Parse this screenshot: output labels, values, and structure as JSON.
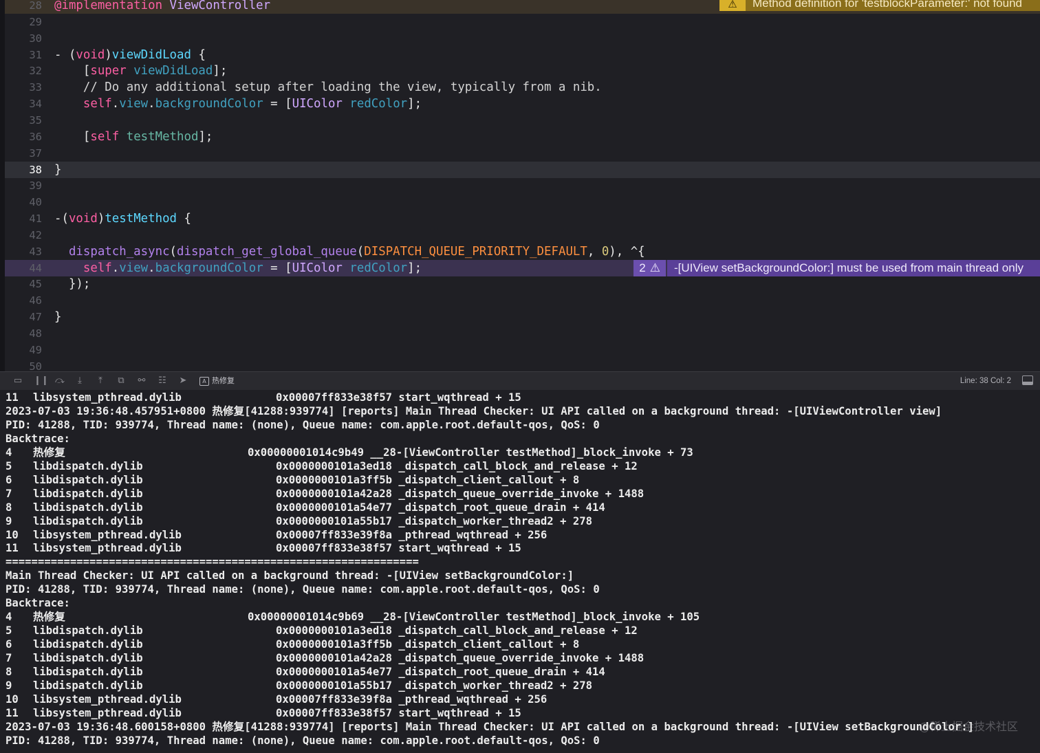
{
  "editor": {
    "lines": [
      {
        "no": "28",
        "tokens": [
          {
            "t": "@implementation",
            "c": "t-at"
          },
          {
            "t": " ",
            "c": "t-plain"
          },
          {
            "t": "ViewController",
            "c": "t-cls"
          }
        ],
        "kind": "warn"
      },
      {
        "no": "29",
        "tokens": []
      },
      {
        "no": "30",
        "tokens": []
      },
      {
        "no": "31",
        "tokens": [
          {
            "t": "- (",
            "c": "t-plain"
          },
          {
            "t": "void",
            "c": "t-kw"
          },
          {
            "t": ")",
            "c": "t-plain"
          },
          {
            "t": "viewDidLoad",
            "c": "t-prop"
          },
          {
            "t": " {",
            "c": "t-plain"
          }
        ]
      },
      {
        "no": "32",
        "tokens": [
          {
            "t": "    [",
            "c": "t-plain"
          },
          {
            "t": "super",
            "c": "t-kw"
          },
          {
            "t": " ",
            "c": "t-plain"
          },
          {
            "t": "viewDidLoad",
            "c": "t-method"
          },
          {
            "t": "];",
            "c": "t-plain"
          }
        ]
      },
      {
        "no": "33",
        "tokens": [
          {
            "t": "    // Do any additional setup after loading the view, typically from a nib.",
            "c": "t-cmt"
          }
        ]
      },
      {
        "no": "34",
        "tokens": [
          {
            "t": "    ",
            "c": "t-plain"
          },
          {
            "t": "self",
            "c": "t-self"
          },
          {
            "t": ".",
            "c": "t-plain"
          },
          {
            "t": "view",
            "c": "t-method"
          },
          {
            "t": ".",
            "c": "t-plain"
          },
          {
            "t": "backgroundColor",
            "c": "t-method"
          },
          {
            "t": " = [",
            "c": "t-plain"
          },
          {
            "t": "UIColor",
            "c": "t-cls"
          },
          {
            "t": " ",
            "c": "t-plain"
          },
          {
            "t": "redColor",
            "c": "t-method"
          },
          {
            "t": "];",
            "c": "t-plain"
          }
        ]
      },
      {
        "no": "35",
        "tokens": []
      },
      {
        "no": "36",
        "tokens": [
          {
            "t": "    [",
            "c": "t-plain"
          },
          {
            "t": "self",
            "c": "t-self"
          },
          {
            "t": " ",
            "c": "t-plain"
          },
          {
            "t": "testMethod",
            "c": "t-fn"
          },
          {
            "t": "];",
            "c": "t-plain"
          }
        ]
      },
      {
        "no": "37",
        "tokens": []
      },
      {
        "no": "38",
        "tokens": [
          {
            "t": "}",
            "c": "t-plain"
          }
        ],
        "kind": "current"
      },
      {
        "no": "39",
        "tokens": []
      },
      {
        "no": "40",
        "tokens": []
      },
      {
        "no": "41",
        "tokens": [
          {
            "t": "-(",
            "c": "t-plain"
          },
          {
            "t": "void",
            "c": "t-kw"
          },
          {
            "t": ")",
            "c": "t-plain"
          },
          {
            "t": "testMethod",
            "c": "t-prop"
          },
          {
            "t": " {",
            "c": "t-plain"
          }
        ]
      },
      {
        "no": "42",
        "tokens": []
      },
      {
        "no": "43",
        "tokens": [
          {
            "t": "  ",
            "c": "t-plain"
          },
          {
            "t": "dispatch_async",
            "c": "t-kw2"
          },
          {
            "t": "(",
            "c": "t-plain"
          },
          {
            "t": "dispatch_get_global_queue",
            "c": "t-kw2"
          },
          {
            "t": "(",
            "c": "t-plain"
          },
          {
            "t": "DISPATCH_QUEUE_PRIORITY_DEFAULT",
            "c": "t-macro"
          },
          {
            "t": ", ",
            "c": "t-plain"
          },
          {
            "t": "0",
            "c": "t-num"
          },
          {
            "t": "), ^{",
            "c": "t-plain"
          }
        ]
      },
      {
        "no": "44",
        "tokens": [
          {
            "t": "    ",
            "c": "t-plain"
          },
          {
            "t": "self",
            "c": "t-self"
          },
          {
            "t": ".",
            "c": "t-plain"
          },
          {
            "t": "view",
            "c": "t-method"
          },
          {
            "t": ".",
            "c": "t-plain"
          },
          {
            "t": "backgroundColor",
            "c": "t-method"
          },
          {
            "t": " = [",
            "c": "t-plain"
          },
          {
            "t": "UIColor",
            "c": "t-cls"
          },
          {
            "t": " ",
            "c": "t-plain"
          },
          {
            "t": "redColor",
            "c": "t-method"
          },
          {
            "t": "];",
            "c": "t-plain"
          }
        ],
        "kind": "runtime"
      },
      {
        "no": "45",
        "tokens": [
          {
            "t": "  });",
            "c": "t-plain"
          }
        ]
      },
      {
        "no": "46",
        "tokens": []
      },
      {
        "no": "47",
        "tokens": [
          {
            "t": "}",
            "c": "t-plain"
          }
        ]
      },
      {
        "no": "48",
        "tokens": []
      },
      {
        "no": "49",
        "tokens": []
      },
      {
        "no": "50",
        "tokens": []
      }
    ],
    "warning_issue": {
      "icon": "warning-triangle-icon",
      "message": "Method definition for 'testblockParameter:' not found"
    },
    "runtime_issue": {
      "count": "2",
      "icon": "warning-triangle-icon",
      "message": "-[UIView setBackgroundColor:] must be used from main thread only"
    }
  },
  "debug_bar": {
    "process_name": "热修复",
    "line_col": "Line: 38  Col: 2",
    "buttons": [
      "hide-console-icon",
      "pause-icon",
      "step-over-icon",
      "step-into-icon",
      "step-out-icon",
      "view-hierarchy-icon",
      "memory-graph-icon",
      "environment-icon",
      "location-icon"
    ]
  },
  "console": {
    "lines": [
      {
        "a": "11",
        "b": "libsystem_pthread.dylib",
        "c": "0x00007ff833e38f57 start_wqthread + 15",
        "offset": "short"
      },
      {
        "text": "2023-07-03 19:36:48.457951+0800 热修复[41288:939774] [reports] Main Thread Checker: UI API called on a background thread: -[UIViewController view]"
      },
      {
        "text": "PID: 41288, TID: 939774, Thread name: (none), Queue name: com.apple.root.default-qos, QoS: 0"
      },
      {
        "text": "Backtrace:"
      },
      {
        "a": "4",
        "b": "热修复",
        "c": "0x00000001014c9b49 __28-[ViewController testMethod]_block_invoke + 73",
        "offset": "long"
      },
      {
        "a": "5",
        "b": "libdispatch.dylib",
        "c": "0x0000000101a3ed18 _dispatch_call_block_and_release + 12",
        "offset": "short"
      },
      {
        "a": "6",
        "b": "libdispatch.dylib",
        "c": "0x0000000101a3ff5b _dispatch_client_callout + 8",
        "offset": "short"
      },
      {
        "a": "7",
        "b": "libdispatch.dylib",
        "c": "0x0000000101a42a28 _dispatch_queue_override_invoke + 1488",
        "offset": "short"
      },
      {
        "a": "8",
        "b": "libdispatch.dylib",
        "c": "0x0000000101a54e77 _dispatch_root_queue_drain + 414",
        "offset": "short"
      },
      {
        "a": "9",
        "b": "libdispatch.dylib",
        "c": "0x0000000101a55b17 _dispatch_worker_thread2 + 278",
        "offset": "short"
      },
      {
        "a": "10",
        "b": "libsystem_pthread.dylib",
        "c": "0x00007ff833e39f8a _pthread_wqthread + 256",
        "offset": "short"
      },
      {
        "a": "11",
        "b": "libsystem_pthread.dylib",
        "c": "0x00007ff833e38f57 start_wqthread + 15",
        "offset": "short"
      },
      {
        "text": "================================================================"
      },
      {
        "text": "Main Thread Checker: UI API called on a background thread: -[UIView setBackgroundColor:]"
      },
      {
        "text": "PID: 41288, TID: 939774, Thread name: (none), Queue name: com.apple.root.default-qos, QoS: 0"
      },
      {
        "text": "Backtrace:"
      },
      {
        "a": "4",
        "b": "热修复",
        "c": "0x00000001014c9b69 __28-[ViewController testMethod]_block_invoke + 105",
        "offset": "long"
      },
      {
        "a": "5",
        "b": "libdispatch.dylib",
        "c": "0x0000000101a3ed18 _dispatch_call_block_and_release + 12",
        "offset": "short"
      },
      {
        "a": "6",
        "b": "libdispatch.dylib",
        "c": "0x0000000101a3ff5b _dispatch_client_callout + 8",
        "offset": "short"
      },
      {
        "a": "7",
        "b": "libdispatch.dylib",
        "c": "0x0000000101a42a28 _dispatch_queue_override_invoke + 1488",
        "offset": "short"
      },
      {
        "a": "8",
        "b": "libdispatch.dylib",
        "c": "0x0000000101a54e77 _dispatch_root_queue_drain + 414",
        "offset": "short"
      },
      {
        "a": "9",
        "b": "libdispatch.dylib",
        "c": "0x0000000101a55b17 _dispatch_worker_thread2 + 278",
        "offset": "short"
      },
      {
        "a": "10",
        "b": "libsystem_pthread.dylib",
        "c": "0x00007ff833e39f8a _pthread_wqthread + 256",
        "offset": "short"
      },
      {
        "a": "11",
        "b": "libsystem_pthread.dylib",
        "c": "0x00007ff833e38f57 start_wqthread + 15",
        "offset": "short"
      },
      {
        "text": "2023-07-03 19:36:48.600158+0800 热修复[41288:939774] [reports] Main Thread Checker: UI API called on a background thread: -[UIView setBackgroundColor:]"
      },
      {
        "text": "PID: 41288, TID: 939774, Thread name: (none), Queue name: com.apple.root.default-qos, QoS: 0"
      }
    ]
  },
  "watermark": "@稀土掘金技术社区"
}
